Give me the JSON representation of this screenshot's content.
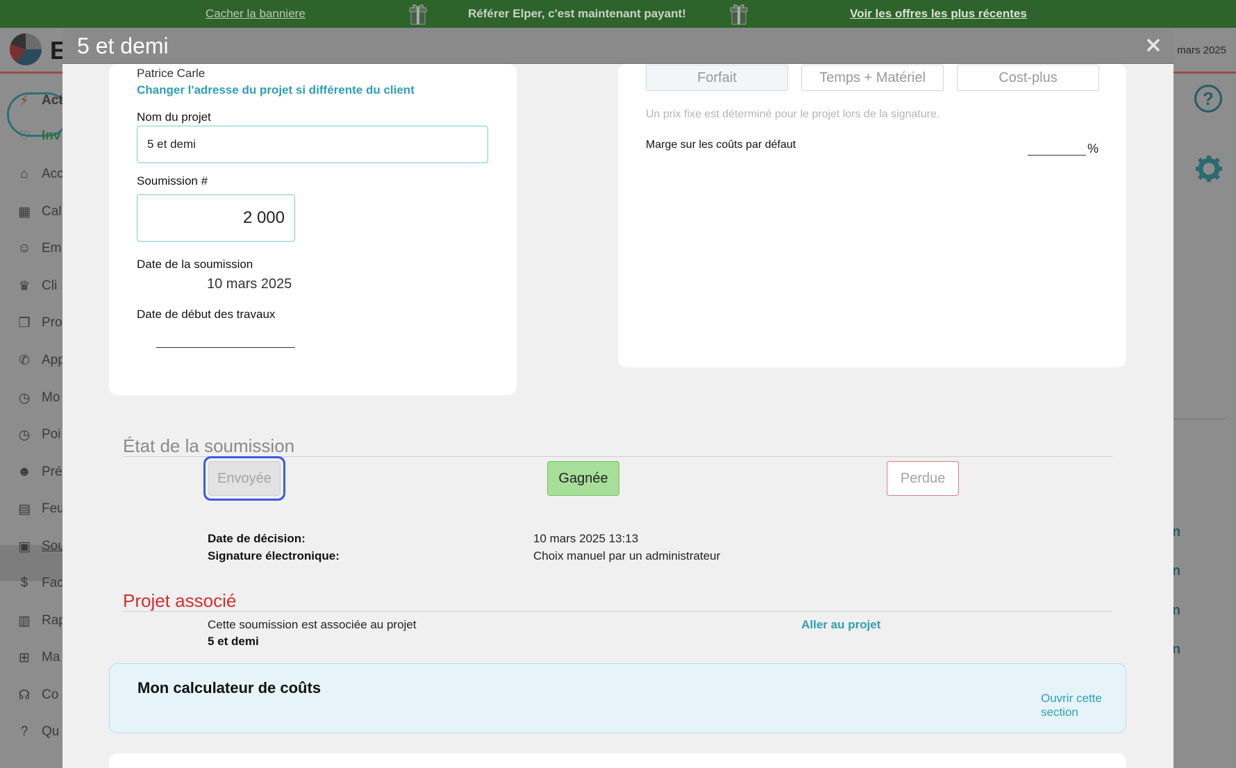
{
  "banner": {
    "hide_label": "Cacher la banniere",
    "promo_text": "Référer Elper, c'est maintenant payant!",
    "offers_label": "Voir les offres les plus récentes"
  },
  "background": {
    "logo_letter": "E",
    "date_fragment": "mars 2025",
    "sidebar": [
      {
        "label": "Act",
        "icon": "lightning-icon"
      },
      {
        "label": "Inv",
        "icon": "heart-handshake-icon"
      },
      {
        "label": "Acc",
        "icon": "home-icon"
      },
      {
        "label": "Cal",
        "icon": "calendar-icon"
      },
      {
        "label": "Em",
        "icon": "users-icon"
      },
      {
        "label": "Cli",
        "icon": "crown-icon"
      },
      {
        "label": "Pro",
        "icon": "copy-icon"
      },
      {
        "label": "App",
        "icon": "phone-icon"
      },
      {
        "label": "Mo",
        "icon": "clock-icon"
      },
      {
        "label": "Poi",
        "icon": "clock-icon"
      },
      {
        "label": "Pré",
        "icon": "user-icon"
      },
      {
        "label": "Feu",
        "icon": "timesheet-icon"
      },
      {
        "label": "Sou",
        "icon": "calculator-icon"
      },
      {
        "label": "Fac",
        "icon": "invoice-icon"
      },
      {
        "label": "Rap",
        "icon": "clipboard-icon"
      },
      {
        "label": "Ma",
        "icon": "map-icon"
      },
      {
        "label": "Co",
        "icon": "headset-icon"
      },
      {
        "label": "Qu",
        "icon": "question-icon"
      }
    ],
    "help_glyph": "?",
    "right_letters": [
      "n",
      "n",
      "n",
      "n"
    ]
  },
  "modal": {
    "title": "5 et demi",
    "client_name": "Patrice Carle",
    "change_address_label": "Changer l'adresse du projet si différente du client",
    "project_name_label": "Nom du projet",
    "project_name_value": "5 et demi",
    "quote_number_label": "Soumission #",
    "quote_number_value": "2 000",
    "quote_date_label": "Date de la soumission",
    "quote_date_value": "10 mars 2025",
    "start_date_label": "Date de début des travaux",
    "pricing": {
      "options": [
        "Forfait",
        "Temps + Matériel",
        "Cost-plus"
      ],
      "selected": "Forfait",
      "description": "Un prix fixe est déterminé pour le projet lors de la signature.",
      "margin_label": "Marge sur les coûts par défaut",
      "margin_unit": "%"
    },
    "status": {
      "title": "État de la soumission",
      "sent_label": "Envoyée",
      "won_label": "Gagnée",
      "lost_label": "Perdue",
      "decision_date_label": "Date de décision:",
      "decision_date_value": "10 mars 2025 13:13",
      "signature_label": "Signature électronique:",
      "signature_value": "Choix manuel par un administrateur"
    },
    "associated": {
      "title": "Projet associé",
      "text": "Cette soumission est associée au projet",
      "project_name": "5 et demi",
      "goto_label": "Aller au projet"
    },
    "calculator": {
      "title": "Mon calculateur de coûts",
      "open_label": "Ouvrir cette section"
    }
  },
  "colors": {
    "banner_bg": "#2e632c",
    "link": "#2e9fb5",
    "section_red": "#d32f2f",
    "won_green": "#a7df9a",
    "lost_border": "#e07a85",
    "focus_blue": "#3d5ce0"
  }
}
